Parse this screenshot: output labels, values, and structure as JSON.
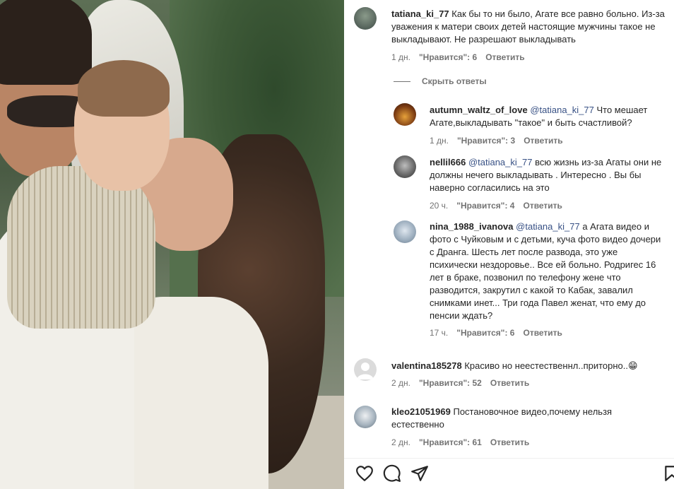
{
  "post": {
    "actions": {
      "like_icon": "heart-icon",
      "comment_icon": "comment-icon",
      "share_icon": "share-icon",
      "save_icon": "bookmark-icon"
    }
  },
  "comments": [
    {
      "user": "tatiana_ki_77",
      "text": "Как бы то ни было, Агате все равно больно. Из-за уважения к матери своих детей настоящие мужчины такое не выкладывают. Не разрешают выкладывать",
      "time": "1 дн.",
      "likes": "\"Нравится\": 6",
      "reply": "Ответить"
    }
  ],
  "hide_replies": "Скрыть ответы",
  "replies": [
    {
      "user": "autumn_waltz_of_love",
      "mention": "@tatiana_ki_77",
      "text": " Что мешает Агате,выкладывать \"такое\" и быть счастливой?",
      "time": "1 дн.",
      "likes": "\"Нравится\": 3",
      "reply": "Ответить"
    },
    {
      "user": "nellil666",
      "mention": "@tatiana_ki_77",
      "text": " всю жизнь из-за Агаты они не должны нечего выкладывать . Интересно . Вы бы наверно согласились на это",
      "time": "20 ч.",
      "likes": "\"Нравится\": 4",
      "reply": "Ответить"
    },
    {
      "user": "nina_1988_ivanova",
      "mention": "@tatiana_ki_77",
      "text": " а Агата видео и фото с Чуйковым и с детьми, куча фото видео дочери с Дранга. Шесть лет после развода, это уже психически нездоровье.. Все ей больно. Родригес 16 лет в браке, позвонил по телефону жене что разводится, закрутил с какой то Кабак, завалил снимками инет... Три года Павел женат, что ему до пенсии ждать?",
      "time": "17 ч.",
      "likes": "\"Нравится\": 6",
      "reply": "Ответить"
    }
  ],
  "more_comments": [
    {
      "user": "valentina185278",
      "text": "Красиво но неестественнл..приторно..😁",
      "time": "2 дн.",
      "likes": "\"Нравится\": 52",
      "reply": "Ответить"
    },
    {
      "user": "kleo21051969",
      "text": "Постановочное видео,почему нельзя естественно",
      "time": "2 дн.",
      "likes": "\"Нравится\": 61",
      "reply": "Ответить"
    }
  ]
}
